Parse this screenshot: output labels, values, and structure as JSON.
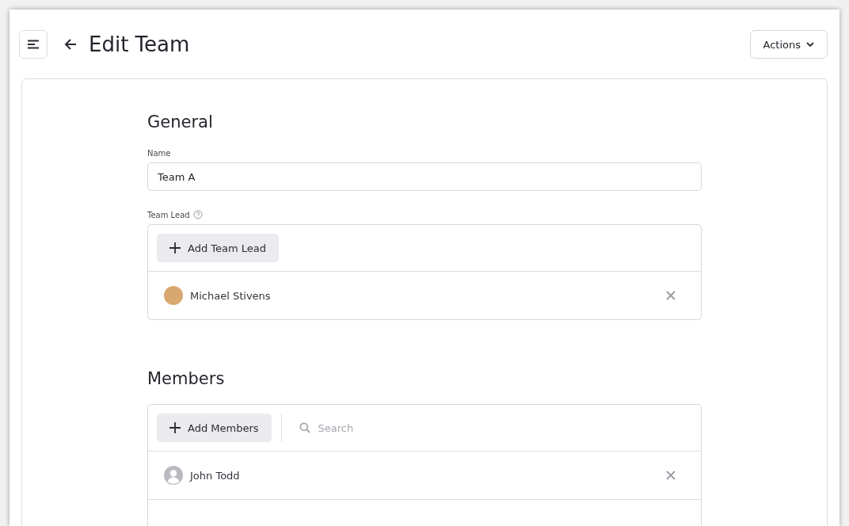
{
  "header": {
    "title": "Edit Team",
    "actions_button": "Actions"
  },
  "general": {
    "heading": "General",
    "name_label": "Name",
    "name_value": "Team A",
    "lead_label": "Team Lead",
    "add_lead_button": "Add Team Lead",
    "leads": [
      {
        "name": "Michael Stivens",
        "kind": "photo"
      }
    ]
  },
  "members": {
    "heading": "Members",
    "add_button": "Add Members",
    "search": {
      "placeholder": "Search"
    },
    "items": [
      {
        "name": "John Todd",
        "kind": "default"
      }
    ]
  }
}
